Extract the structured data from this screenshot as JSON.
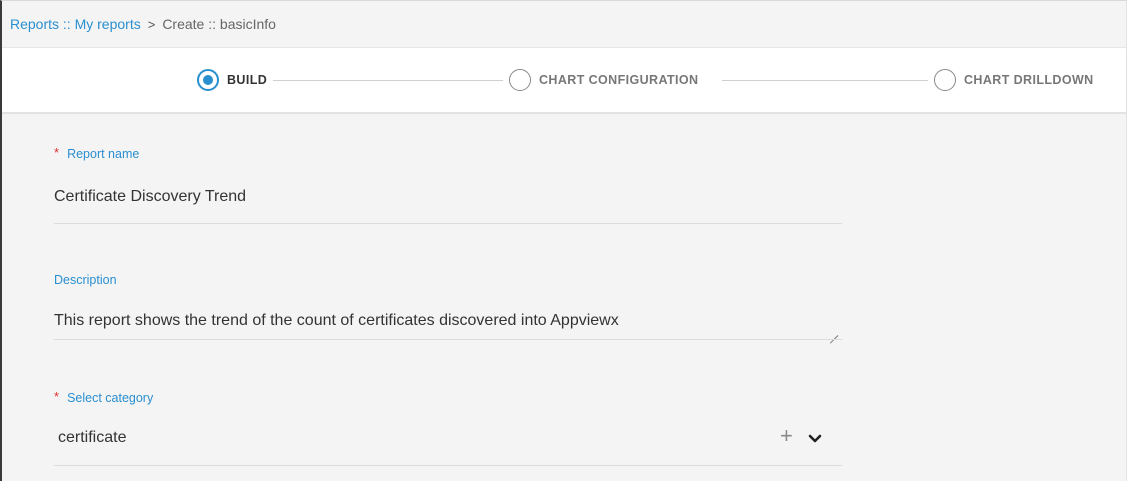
{
  "breadcrumb": {
    "reports": "Reports",
    "sep1": "::",
    "my_reports": "My reports",
    "arrow": ">",
    "create": "Create",
    "sep2": "::",
    "basic_info": "basicInfo"
  },
  "stepper": {
    "steps": [
      {
        "label": "BUILD",
        "active": true
      },
      {
        "label": "CHART CONFIGURATION",
        "active": false
      },
      {
        "label": "CHART DRILLDOWN",
        "active": false
      }
    ]
  },
  "form": {
    "report_name": {
      "label": "Report name",
      "required_mark": "*",
      "value": "Certificate Discovery Trend"
    },
    "description": {
      "label": "Description",
      "value": "This report shows the trend of the count of certificates discovered into Appviewx"
    },
    "category": {
      "label": "Select category",
      "required_mark": "*",
      "value": "certificate",
      "add_icon": "plus-icon",
      "dropdown_icon": "chevron-down-icon"
    }
  },
  "colors": {
    "accent": "#2a8fd0",
    "required": "#e0302b",
    "form_bg": "#f4f4f4"
  }
}
